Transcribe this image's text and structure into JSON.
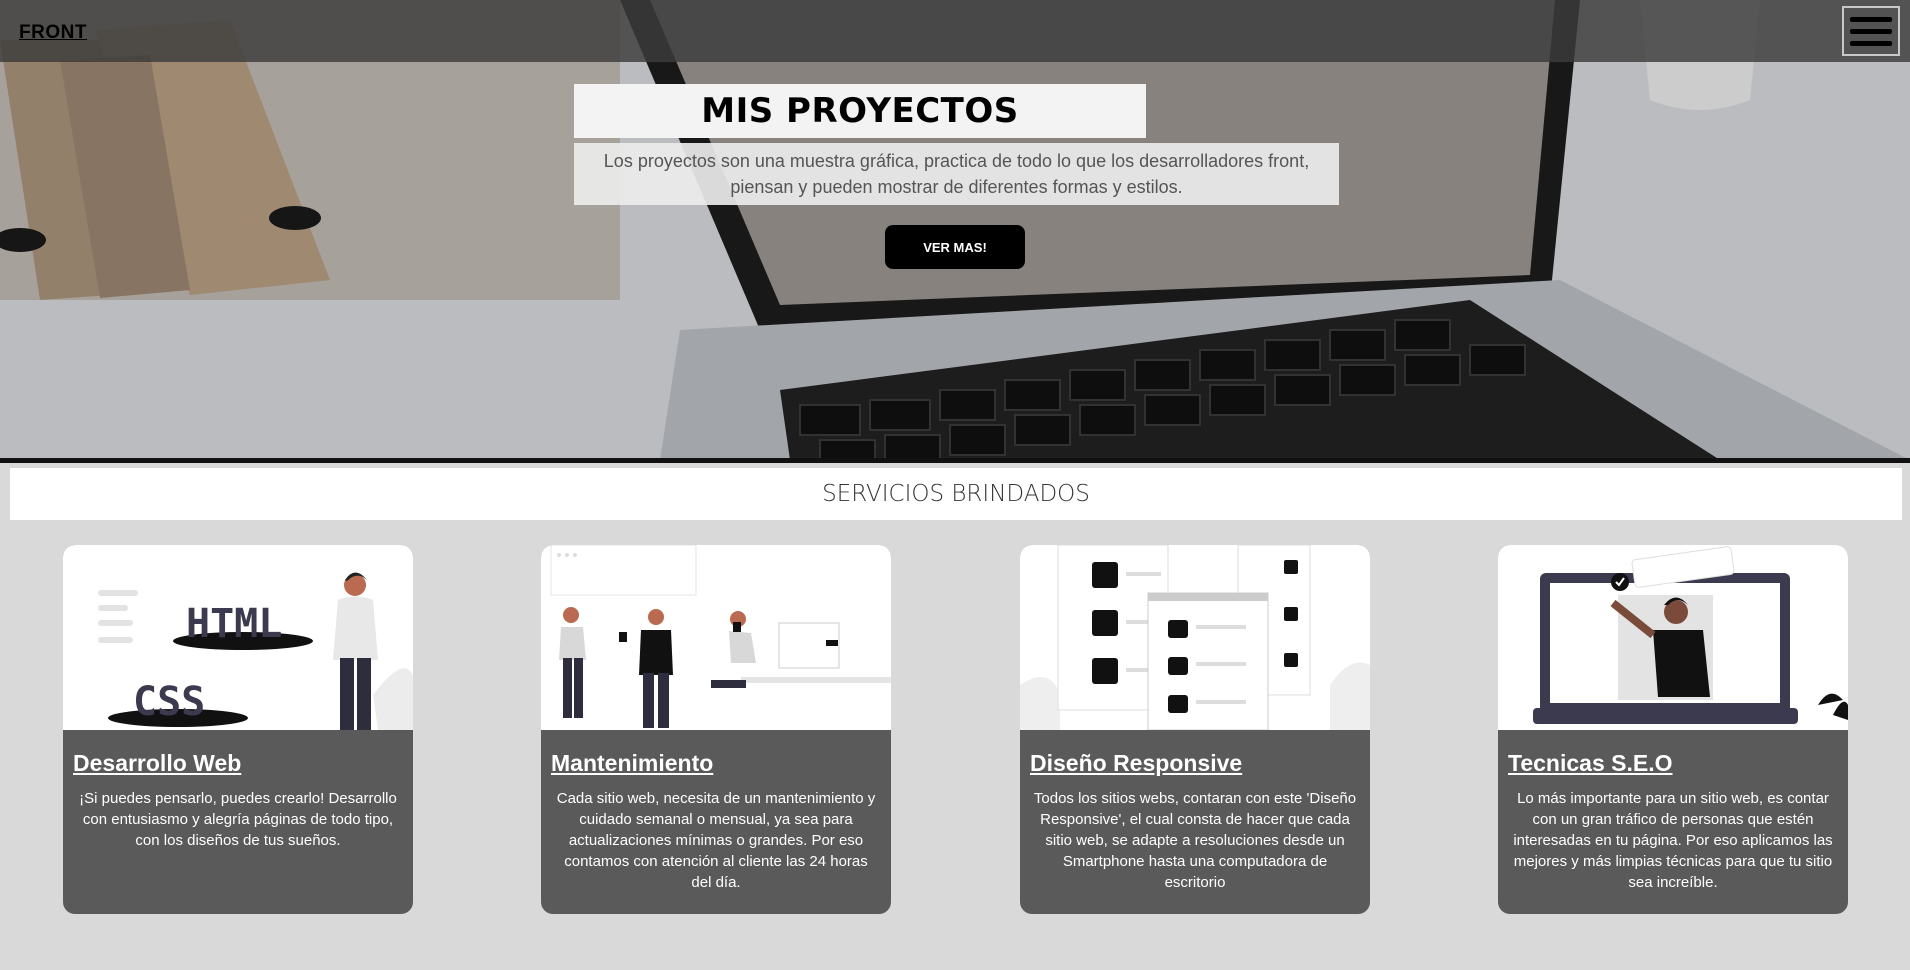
{
  "navbar": {
    "brand": "FRONT",
    "menu_icon": "hamburger-icon"
  },
  "hero": {
    "title": "MIS PROYECTOS",
    "description": "Los proyectos son una muestra gráfica, practica de todo lo que los desarrolladores front, piensan y pueden mostrar de diferentes formas y estilos.",
    "button_label": "VER MAS!"
  },
  "services": {
    "heading": "SERVICIOS BRINDADOS",
    "cards": [
      {
        "title": "Desarrollo Web",
        "text": "¡Si puedes pensarlo, puedes crearlo! Desarrollo con entusiasmo y alegría páginas de todo tipo, con los diseños de tus sueños.",
        "illustration_labels": [
          "HTML",
          "CSS"
        ]
      },
      {
        "title": "Mantenimiento",
        "text": "Cada sitio web, necesita de un mantenimiento y cuidado semanal o mensual, ya sea para actualizaciones mínimas o grandes. Por eso contamos con atención al cliente las 24 horas del día."
      },
      {
        "title": "Diseño Responsive",
        "text": "Todos los sitios webs, contaran con este 'Diseño Responsive', el cual consta de hacer que cada sitio web, se adapte a resoluciones desde un Smartphone hasta una computadora de escritorio"
      },
      {
        "title": "Tecnicas S.E.O",
        "text": "Lo más importante para un sitio web, es contar con un gran tráfico de personas que estén interesadas en tu página. Por eso aplicamos las mejores y más limpias técnicas para que tu sitio sea increíble."
      }
    ]
  },
  "colors": {
    "navbar_bg": "#3c3c3c",
    "page_bg": "#d9d9d9",
    "card_bg": "#5a5a5a",
    "button_bg": "#000000"
  }
}
